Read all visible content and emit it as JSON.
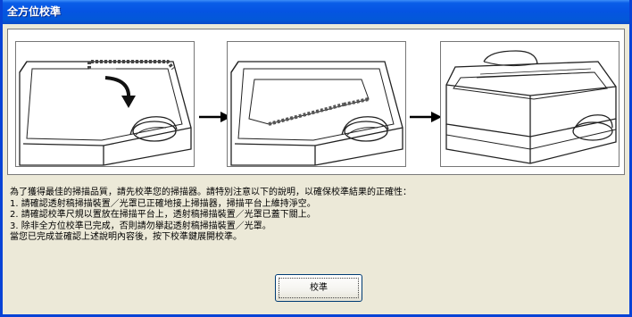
{
  "window": {
    "title": "全方位校準"
  },
  "instructions": {
    "lines": [
      "為了獲得最佳的掃描品質，請先校準您的掃描器。請特別注意以下的說明，以確保校準結果的正確性：",
      "1. 請確認透射稿掃描裝置／光罩已正確地接上掃描器，掃描平台上維持淨空。",
      "2. 請確認校準尺規以置放在掃描平台上，透射稿掃描裝置／光罩已蓋下關上。",
      "3. 除非全方位校準已完成，否則請勿舉起透射稿掃描裝置／光罩。",
      "當您已完成並確認上述說明內容後，按下校準鍵展開校準。"
    ]
  },
  "buttons": {
    "calibrate_label": "校準"
  },
  "icons": {
    "step_arrow": "right-arrow-icon"
  },
  "colors": {
    "titlebar": "#0554e3",
    "dialog_bg": "#ece9d8",
    "frame": "#0843d6"
  }
}
